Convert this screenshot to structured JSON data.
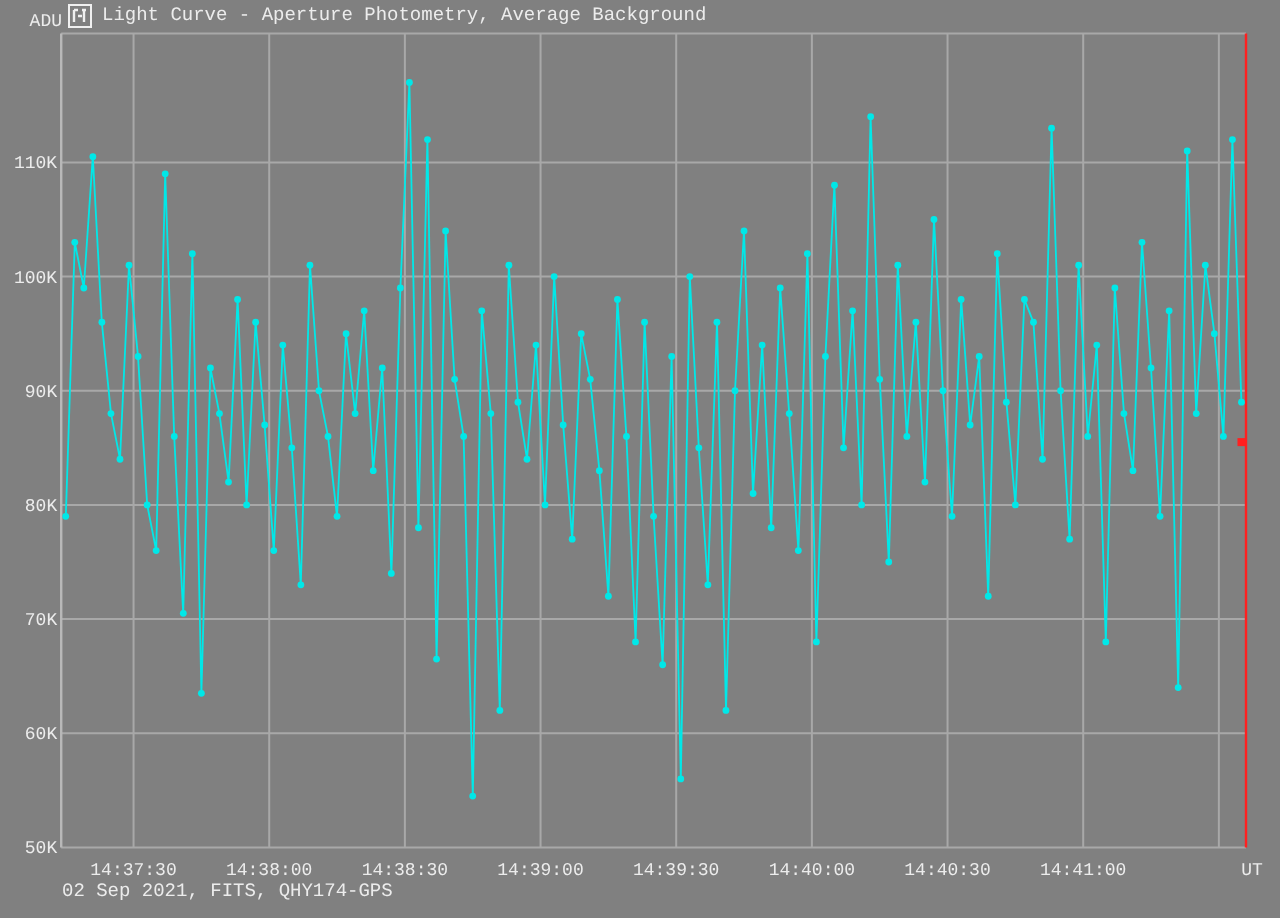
{
  "window": {
    "title": "Light Curve - Aperture Photometry, Average Background"
  },
  "chart_data": {
    "type": "line",
    "ylabel": "ADU",
    "xlabel": "UT",
    "xlim": [
      52634,
      52896
    ],
    "ylim": [
      50,
      121.3
    ],
    "xticks": [
      {
        "value": 52650,
        "label": "14:37:30"
      },
      {
        "value": 52680,
        "label": "14:38:00"
      },
      {
        "value": 52710,
        "label": "14:38:30"
      },
      {
        "value": 52740,
        "label": "14:39:00"
      },
      {
        "value": 52770,
        "label": "14:39:30"
      },
      {
        "value": 52800,
        "label": "14:40:00"
      },
      {
        "value": 52830,
        "label": "14:40:30"
      },
      {
        "value": 52860,
        "label": "14:41:00"
      }
    ],
    "yticks": [
      {
        "value": 50,
        "label": "50K"
      },
      {
        "value": 60,
        "label": "60K"
      },
      {
        "value": 70,
        "label": "70K"
      },
      {
        "value": 80,
        "label": "80K"
      },
      {
        "value": 90,
        "label": "90K"
      },
      {
        "value": 100,
        "label": "100K"
      },
      {
        "value": 110,
        "label": "110K"
      }
    ],
    "x": [
      52635,
      52637,
      52639,
      52641,
      52643,
      52645,
      52647,
      52649,
      52651,
      52653,
      52655,
      52657,
      52659,
      52661,
      52663,
      52665,
      52667,
      52669,
      52671,
      52673,
      52675,
      52677,
      52679,
      52681,
      52683,
      52685,
      52687,
      52689,
      52691,
      52693,
      52695,
      52697,
      52699,
      52701,
      52703,
      52705,
      52707,
      52709,
      52711,
      52713,
      52715,
      52717,
      52719,
      52721,
      52723,
      52725,
      52727,
      52729,
      52731,
      52733,
      52735,
      52737,
      52739,
      52741,
      52743,
      52745,
      52747,
      52749,
      52751,
      52753,
      52755,
      52757,
      52759,
      52761,
      52763,
      52765,
      52767,
      52769,
      52771,
      52773,
      52775,
      52777,
      52779,
      52781,
      52783,
      52785,
      52787,
      52789,
      52791,
      52793,
      52795,
      52797,
      52799,
      52801,
      52803,
      52805,
      52807,
      52809,
      52811,
      52813,
      52815,
      52817,
      52819,
      52821,
      52823,
      52825,
      52827,
      52829,
      52831,
      52833,
      52835,
      52837,
      52839,
      52841,
      52843,
      52845,
      52847,
      52849,
      52851,
      52853,
      52855,
      52857,
      52859,
      52861,
      52863,
      52865,
      52867,
      52869,
      52871,
      52873,
      52875,
      52877,
      52879,
      52881,
      52883,
      52885,
      52887,
      52889,
      52891,
      52893,
      52895
    ],
    "series": [
      {
        "color": "#00e8e8",
        "marker": "circle",
        "values": [
          79,
          103,
          99,
          110.5,
          96,
          88,
          84,
          101,
          93,
          80,
          76,
          109,
          86,
          70.5,
          102,
          63.5,
          92,
          88,
          82,
          98,
          80,
          96,
          87,
          76,
          94,
          85,
          73,
          101,
          90,
          86,
          79,
          95,
          88,
          97,
          83,
          92,
          74,
          99,
          117,
          78,
          112,
          66.5,
          104,
          91,
          86,
          54.5,
          97,
          88,
          62,
          101,
          89,
          84,
          94,
          80,
          100,
          87,
          77,
          95,
          91,
          83,
          72,
          98,
          86,
          68,
          96,
          79,
          66,
          93,
          56,
          100,
          85,
          73,
          96,
          62,
          90,
          104,
          81,
          94,
          78,
          99,
          88,
          76,
          102,
          68,
          93,
          108,
          85,
          97,
          80,
          114,
          91,
          75,
          101,
          86,
          96,
          82,
          105,
          90,
          79,
          98,
          87,
          93,
          72,
          102,
          89,
          80,
          98,
          96,
          84,
          113,
          90,
          77,
          101,
          86,
          94,
          68,
          99,
          88,
          83,
          103,
          92,
          79,
          97,
          64,
          111,
          88,
          101,
          95,
          86,
          112,
          89
        ]
      },
      {
        "color": "#ff2020",
        "marker": "square",
        "values": [
          null,
          null,
          null,
          null,
          null,
          null,
          null,
          null,
          null,
          null,
          null,
          null,
          null,
          null,
          null,
          null,
          null,
          null,
          null,
          null,
          null,
          null,
          null,
          null,
          null,
          null,
          null,
          null,
          null,
          null,
          null,
          null,
          null,
          null,
          null,
          null,
          null,
          null,
          null,
          null,
          null,
          null,
          null,
          null,
          null,
          null,
          null,
          null,
          null,
          null,
          null,
          null,
          null,
          null,
          null,
          null,
          null,
          null,
          null,
          null,
          null,
          null,
          null,
          null,
          null,
          null,
          null,
          null,
          null,
          null,
          null,
          null,
          null,
          null,
          null,
          null,
          null,
          null,
          null,
          null,
          null,
          null,
          null,
          null,
          null,
          null,
          null,
          null,
          null,
          null,
          null,
          null,
          null,
          null,
          null,
          null,
          null,
          null,
          null,
          null,
          null,
          null,
          null,
          null,
          null,
          null,
          null,
          null,
          null,
          null,
          null,
          null,
          null,
          null,
          null,
          null,
          null,
          null,
          null,
          null,
          null,
          null,
          null,
          null,
          null,
          null,
          null,
          null,
          null,
          null,
          85.5
        ]
      }
    ],
    "grid": true
  },
  "footer": "02 Sep 2021, FITS, QHY174-GPS"
}
